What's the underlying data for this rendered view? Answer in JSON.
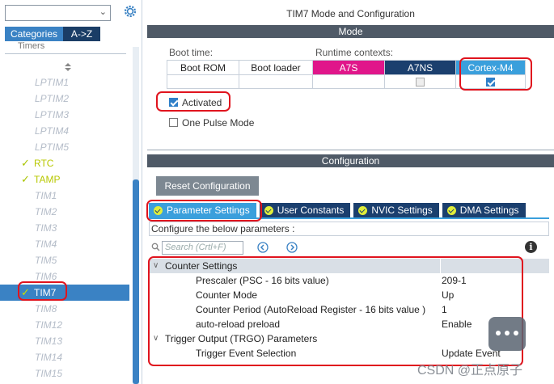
{
  "sidebar": {
    "search_value": "",
    "tabs": [
      "Categories",
      "A->Z"
    ],
    "group_label": "Timers",
    "items": [
      {
        "label": "LPTIM1",
        "state": "disabled"
      },
      {
        "label": "LPTIM2",
        "state": "disabled"
      },
      {
        "label": "LPTIM3",
        "state": "disabled"
      },
      {
        "label": "LPTIM4",
        "state": "disabled"
      },
      {
        "label": "LPTIM5",
        "state": "disabled"
      },
      {
        "label": "RTC",
        "state": "enabled"
      },
      {
        "label": "TAMP",
        "state": "enabled"
      },
      {
        "label": "TIM1",
        "state": "disabled"
      },
      {
        "label": "TIM2",
        "state": "disabled"
      },
      {
        "label": "TIM3",
        "state": "disabled"
      },
      {
        "label": "TIM4",
        "state": "disabled"
      },
      {
        "label": "TIM5",
        "state": "disabled"
      },
      {
        "label": "TIM6",
        "state": "disabled"
      },
      {
        "label": "TIM7",
        "state": "selected"
      },
      {
        "label": "TIM8",
        "state": "disabled"
      },
      {
        "label": "TIM12",
        "state": "disabled"
      },
      {
        "label": "TIM13",
        "state": "disabled"
      },
      {
        "label": "TIM14",
        "state": "disabled"
      },
      {
        "label": "TIM15",
        "state": "disabled"
      }
    ]
  },
  "window": {
    "title": "TIM7 Mode and Configuration"
  },
  "mode": {
    "band_title": "Mode",
    "boot_time_label": "Boot time:",
    "runtime_label": "Runtime contexts:",
    "headers": [
      "Boot ROM",
      "Boot loader",
      "A7S",
      "A7NS",
      "Cortex-M4"
    ],
    "activated_label": "Activated",
    "activated_checked": true,
    "one_pulse_label": "One Pulse Mode",
    "one_pulse_checked": false
  },
  "configuration": {
    "band_title": "Configuration",
    "reset_label": "Reset Configuration",
    "tabs": [
      "Parameter Settings",
      "User Constants",
      "NVIC Settings",
      "DMA Settings"
    ],
    "configure_label": "Configure the below parameters :",
    "search_placeholder": "Search (Crtl+F)",
    "params": [
      {
        "name": "Counter Settings",
        "value": "",
        "group": true
      },
      {
        "name": "Prescaler (PSC - 16 bits value)",
        "value": "209-1"
      },
      {
        "name": "Counter Mode",
        "value": "Up"
      },
      {
        "name": "Counter Period (AutoReload Register - 16 bits value )",
        "value": "1"
      },
      {
        "name": "auto-reload preload",
        "value": "Enable"
      },
      {
        "name": "Trigger Output (TRGO) Parameters",
        "value": "",
        "group": true,
        "plain": true
      },
      {
        "name": "Trigger Event Selection",
        "value": "Update Event"
      }
    ]
  },
  "watermark": "CSDN @正点原子",
  "colors": {
    "accent": "#3a9fdc",
    "dark": "#1b3f6e",
    "a7s": "#e0168a",
    "highlight": "#e0141e"
  }
}
